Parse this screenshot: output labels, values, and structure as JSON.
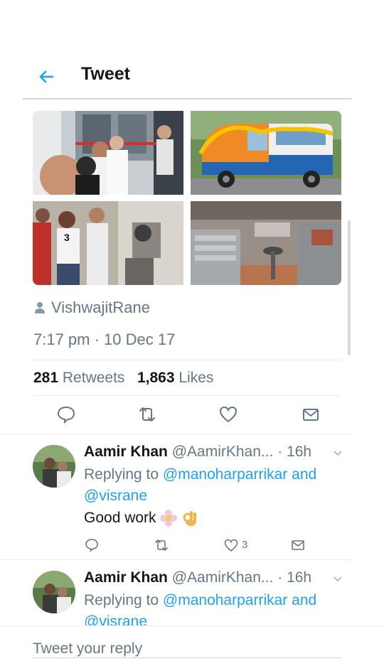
{
  "header": {
    "title": "Tweet",
    "back_icon": "arrow-left-icon",
    "accent": "#1da1f2"
  },
  "tweet": {
    "photos": [
      "photo-ribbon-cutting",
      "photo-decorated-van",
      "photo-interior-visit",
      "photo-van-interior"
    ],
    "source": "VishwajitRane",
    "timestamp": "7:17 pm · 10 Dec 17",
    "retweets_count": "281",
    "retweets_label": "Retweets",
    "likes_count": "1,863",
    "likes_label": "Likes"
  },
  "replies": [
    {
      "name": "Aamir Khan",
      "handle_time": "@AamirKhan... · 16h",
      "replying_prefix": "Replying to",
      "replying_to_1": "@manoharparrikar",
      "replying_and": "and",
      "replying_to_2": "@visrane",
      "text": "Good work",
      "emoji": [
        "flower-emoji",
        "ok-hand-emoji"
      ],
      "like_count": "3"
    },
    {
      "name": "Aamir Khan",
      "handle_time": "@AamirKhan... · 16h",
      "replying_prefix": "Replying to",
      "replying_to_1": "@manoharparrikar",
      "replying_and": "and",
      "replying_to_2": "@visrane"
    }
  ],
  "composer": {
    "placeholder": "Tweet your reply"
  },
  "colors": {
    "text": "#14171a",
    "secondary": "#657786",
    "link": "#1da1f2",
    "divider": "#e6ecf0"
  }
}
